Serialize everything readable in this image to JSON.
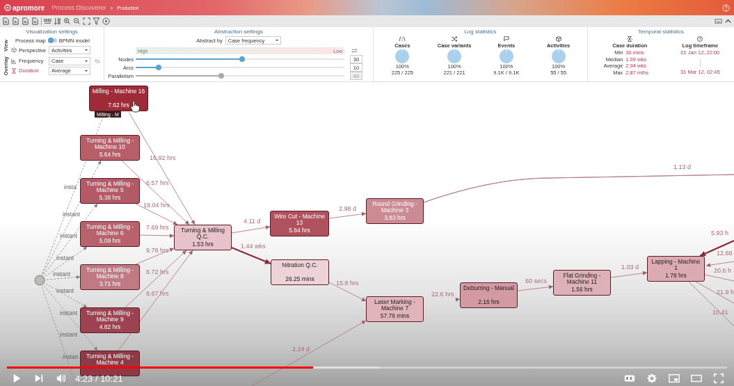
{
  "header": {
    "brand": "apromore",
    "app": "Process Discoverer",
    "separator": ">",
    "breadcrumb": "Production"
  },
  "visualization": {
    "title": "Visualization settings",
    "view_label": "View",
    "overlay_label": "Overlay",
    "map_label": "Process map",
    "bpmn_label": "BPMN model",
    "bpmn_on": false,
    "perspective": {
      "label": "Perspective",
      "value": "Activities"
    },
    "overlays": [
      {
        "kind": "frequency",
        "label": "Frequency",
        "value": "Case",
        "selected": false
      },
      {
        "kind": "duration",
        "label": "Duration",
        "value": "Average",
        "selected": true
      }
    ]
  },
  "abstraction": {
    "title": "Abstraction settings",
    "abstract_by_label": "Abstract by",
    "abstract_by": "Case frequency",
    "high": "High",
    "low": "Low",
    "sliders": [
      {
        "label": "Nodes",
        "level": 0.51,
        "value": "30",
        "disabled": false
      },
      {
        "label": "Arcs",
        "level": 0.11,
        "value": "10",
        "disabled": false
      },
      {
        "label": "Parallelism",
        "level": 0.41,
        "value": "40",
        "disabled": true
      }
    ]
  },
  "log_statistics": {
    "title": "Log statistics",
    "items": [
      {
        "kind": "cases",
        "label": "Cases",
        "level": 1,
        "percent": "100%",
        "count": "225 / 225"
      },
      {
        "kind": "variants",
        "label": "Case variants",
        "level": 1,
        "percent": "100%",
        "count": "221 / 221"
      },
      {
        "kind": "events",
        "label": "Events",
        "level": 1,
        "percent": "100%",
        "count": "9.1K / 9.1K"
      },
      {
        "kind": "activities",
        "label": "Activities",
        "level": 1,
        "percent": "100%",
        "count": "55 / 55"
      }
    ]
  },
  "temporal_statistics": {
    "title": "Temporal statistics",
    "case_duration": {
      "label": "Case duration",
      "rows": [
        {
          "name": "Min",
          "value": "30 mins"
        },
        {
          "name": "Median",
          "value": "1.09 wks"
        },
        {
          "name": "Average",
          "value": "2.94 wks"
        },
        {
          "name": "Max",
          "value": "2.87 mths"
        }
      ]
    },
    "timeframe": {
      "label": "Log timeframe",
      "start": "01 Jan 12, 22:00",
      "end": "31 Mar 12, 02:45"
    }
  },
  "map": {
    "tooltip": "Milling - M",
    "nodes": [
      {
        "title": "Milling - Machine 16",
        "duration": "7.62 hrs",
        "color": "#9e2b37"
      },
      {
        "title": "Turning & Milling - Machine 10",
        "duration": "5.64 hrs",
        "color": "#b85e69"
      },
      {
        "title": "Turning & Milling - Machine 5",
        "duration": "5.38 hrs",
        "color": "#b45a66"
      },
      {
        "title": "Turning & Milling - Machine 6",
        "duration": "5.09 hrs",
        "color": "#b8626d"
      },
      {
        "title": "Turning & Milling - Machine 8",
        "duration": "3.71 hrs",
        "color": "#bf7a83"
      },
      {
        "title": "Turning & Milling - Machine 9",
        "duration": "4.82 hrs",
        "color": "#9c4250"
      },
      {
        "title": "Turning & Milling - Machine 4",
        "color": "#8e3a46"
      },
      {
        "title": "Turning & Milling Q.C.",
        "duration": "1.53 hrs",
        "color": "#e8c3c9"
      },
      {
        "title": "Wire Cut - Machine 13",
        "duration": "5.64 hrs",
        "color": "#b0525e"
      },
      {
        "title": "Round Grinding - Machine 3",
        "duration": "3.83 hrs",
        "color": "#cc8a93"
      },
      {
        "title": "Nitration Q.C.",
        "duration": "26.25 mins",
        "color": "#edd2d6"
      },
      {
        "title": "Laser Marking - Machine 7",
        "duration": "57.76 mins",
        "color": "#e0b4ba"
      },
      {
        "title": "Deburring - Manual",
        "duration": "2.16 hrs",
        "color": "#d39aa2"
      },
      {
        "title": "Flat Grinding - Machine 11",
        "duration": "1.56 hrs",
        "color": "#deb0b7"
      },
      {
        "title": "Lapping - Machine 1",
        "duration": "1.78 hrs",
        "color": "#dcaab1"
      }
    ],
    "edges": [
      {
        "label": "16.92 hrs"
      },
      {
        "label": "6.57 hrs"
      },
      {
        "label": "19.04 hrs"
      },
      {
        "label": "7.69 hrs"
      },
      {
        "label": "9.78 hrs"
      },
      {
        "label": "6.72 hrs"
      },
      {
        "label": "8.67 hrs"
      },
      {
        "label": "4.11 d"
      },
      {
        "label": "1.44 wks"
      },
      {
        "label": "2.98 d"
      },
      {
        "label": "1.13 d"
      },
      {
        "label": "15.8 hrs"
      },
      {
        "label": "2.24 d"
      },
      {
        "label": "22.6 hrs"
      },
      {
        "label": "60 secs"
      },
      {
        "label": "1.03 d"
      },
      {
        "label": "5.93 h"
      },
      {
        "label": "12.68"
      },
      {
        "label": "20.6 h"
      },
      {
        "label": "21.9 h"
      },
      {
        "label": "10.41"
      }
    ],
    "instant_labels": [
      "insta",
      "instant",
      "instant",
      "instant",
      "instant",
      "instant",
      "instant",
      "instant",
      "instan"
    ]
  },
  "player": {
    "time": "4:23 / 10:21",
    "level": 0.425
  }
}
